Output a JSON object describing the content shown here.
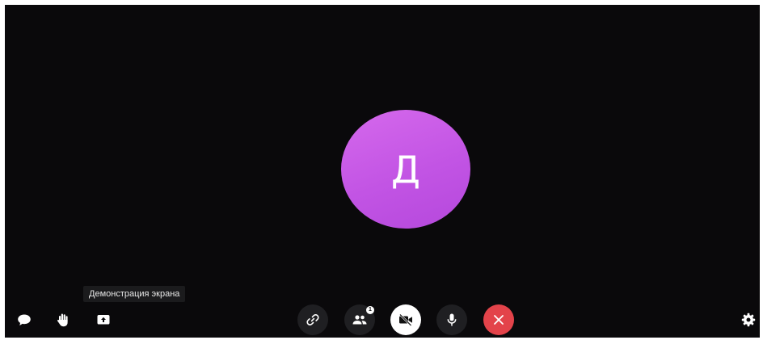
{
  "participant": {
    "initial": "Д"
  },
  "tooltip": {
    "text": "Демонстрация экрана"
  },
  "toolbar": {
    "left": [
      {
        "icon": "chat-icon"
      },
      {
        "icon": "raise-hand-icon"
      },
      {
        "icon": "screen-share-icon"
      }
    ],
    "center": [
      {
        "icon": "link-icon"
      },
      {
        "icon": "participants-icon",
        "badge": "1"
      },
      {
        "icon": "camera-off-icon"
      },
      {
        "icon": "microphone-icon"
      },
      {
        "icon": "close-icon"
      }
    ],
    "right": [
      {
        "icon": "gear-icon"
      }
    ]
  },
  "colors": {
    "background": "#0a090b",
    "avatar": "#c658e6",
    "hangup": "#e3434a",
    "button_dark": "#1f1f22"
  }
}
